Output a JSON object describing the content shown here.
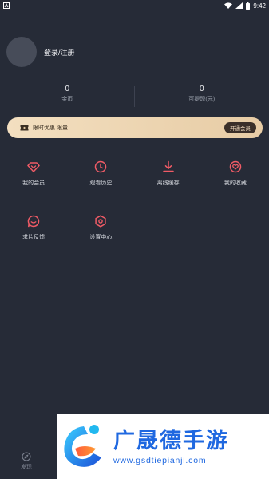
{
  "status_bar": {
    "left_icon": "a-notification-icon",
    "time": "9:42"
  },
  "profile": {
    "login_text": "登录/注册"
  },
  "stats": [
    {
      "value": "0",
      "label": "金币"
    },
    {
      "value": "0",
      "label": "可提现(元)"
    }
  ],
  "vip_banner": {
    "text": "限时优惠 限量",
    "button_label": "开通会员"
  },
  "grid": [
    {
      "label": "我的会员",
      "icon": "diamond-icon"
    },
    {
      "label": "观看历史",
      "icon": "clock-icon"
    },
    {
      "label": "离线缓存",
      "icon": "download-icon"
    },
    {
      "label": "我的收藏",
      "icon": "heart-icon"
    },
    {
      "label": "求片反馈",
      "icon": "feedback-icon"
    },
    {
      "label": "设置中心",
      "icon": "settings-icon"
    }
  ],
  "bottom_tab": {
    "label": "发现"
  },
  "watermark": {
    "title": "广晟德手游",
    "url": "www.gsdtiepianji.com"
  },
  "colors": {
    "background": "#262b37",
    "icon_accent": "#f05b66",
    "vip_gold": "#f3dfc0",
    "watermark_blue": "#1f68e0"
  }
}
